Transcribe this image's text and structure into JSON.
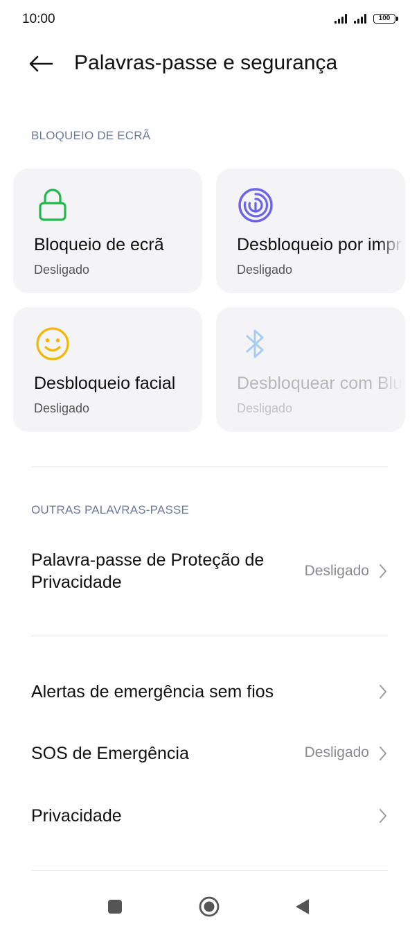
{
  "status_bar": {
    "time": "10:00",
    "battery": "100"
  },
  "header": {
    "title": "Palavras-passe e segurança"
  },
  "screen_lock": {
    "section_label": "BLOQUEIO DE ECRÃ",
    "tiles": [
      {
        "title": "Bloqueio de ecrã",
        "status": "Desligado",
        "icon": "lock-icon",
        "color": "#22b84c"
      },
      {
        "title": "Desbloqueio por impressão digital",
        "status": "Desligado",
        "icon": "fingerprint-icon",
        "color": "#6b63e8"
      },
      {
        "title": "Desbloqueio facial",
        "status": "Desligado",
        "icon": "face-icon",
        "color": "#f2b705"
      },
      {
        "title": "Desbloquear com Bluetooth",
        "status": "Desligado",
        "icon": "bluetooth-icon",
        "color": "#a9cdf2"
      }
    ]
  },
  "other_passwords": {
    "section_label": "OUTRAS PALAVRAS-PASSE",
    "items": [
      {
        "label_line1": "Palavra-passe de Proteção de",
        "label_line2": "Privacidade",
        "value": "Desligado"
      }
    ]
  },
  "more": {
    "items": [
      {
        "label": "Alertas de emergência sem fios",
        "value": ""
      },
      {
        "label": "SOS de Emergência",
        "value": "Desligado"
      },
      {
        "label": "Privacidade",
        "value": ""
      }
    ]
  },
  "nav": {
    "buttons": [
      "recents-icon",
      "home-icon",
      "back-triangle-icon"
    ]
  },
  "colors": {
    "section_label": "#6b7a9a",
    "tile_bg": "#f4f4f6",
    "divider": "#e4e4e8"
  }
}
